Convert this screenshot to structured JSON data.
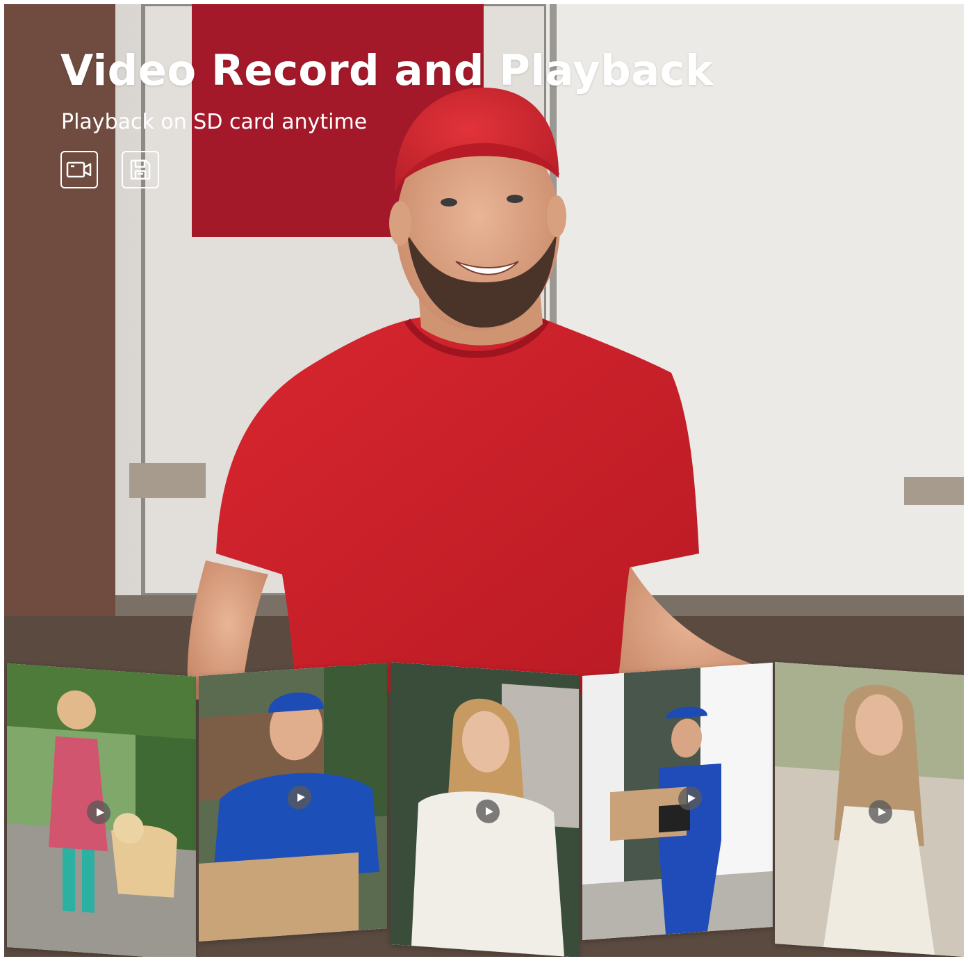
{
  "header": {
    "title": "Video Record and Playback",
    "subtitle": "Playback on SD card anytime"
  },
  "feature_icons": [
    {
      "name": "video-camera-icon"
    },
    {
      "name": "floppy-save-icon"
    }
  ],
  "thumbnails": [
    {
      "subject": "girl walking with golden retriever",
      "play_icon": "play-icon"
    },
    {
      "subject": "delivery man in blue shirt holding box",
      "play_icon": "play-icon"
    },
    {
      "subject": "woman in white coat",
      "play_icon": "play-icon"
    },
    {
      "subject": "delivery worker with box and tablet",
      "play_icon": "play-icon"
    },
    {
      "subject": "woman in white dress",
      "play_icon": "play-icon"
    }
  ],
  "colors": {
    "shirt_red": "#d3232c",
    "cap_red": "#d22a31",
    "van_white": "#e9e7e3",
    "uniform_blue": "#1f4fb4",
    "title_white": "#ffffff"
  }
}
